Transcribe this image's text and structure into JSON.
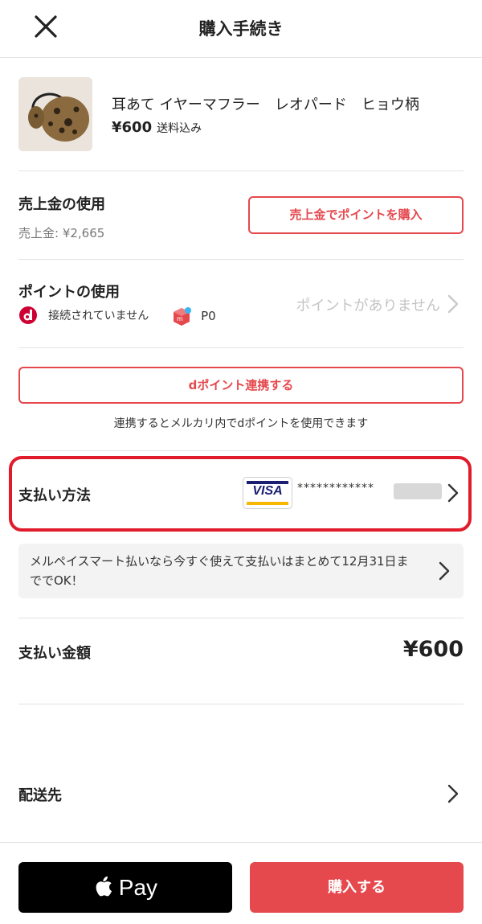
{
  "header": {
    "title": "購入手続き",
    "close_icon": "close-icon"
  },
  "product": {
    "name": "耳あて イヤーマフラー　レオパード　ヒョウ柄",
    "price": "¥600",
    "shipping": "送料込み"
  },
  "sales_proceeds": {
    "title": "売上金の使用",
    "balance": "売上金: ¥2,665",
    "button_label": "売上金でポイントを購入"
  },
  "points": {
    "title": "ポイントの使用",
    "d_status": "接続されていません",
    "m_points": "P0",
    "none_label": "ポイントがありません"
  },
  "d_point_link": {
    "button_label": "dポイント連携する",
    "note": "連携するとメルカリ内でdポイントを使用できます"
  },
  "payment_method": {
    "title": "支払い方法",
    "card_brand": "VISA",
    "card_number": "************"
  },
  "promo": {
    "text": "メルペイスマート払いなら今すぐ使えて支払いはまとめて12月31日まででOK！"
  },
  "total": {
    "label": "支払い金額",
    "amount": "¥600"
  },
  "shipping_address": {
    "label": "配送先"
  },
  "footer": {
    "apple_pay_label": "Pay",
    "buy_label": "購入する"
  },
  "colors": {
    "accent": "#e5484d",
    "highlight": "#e01b2b"
  }
}
